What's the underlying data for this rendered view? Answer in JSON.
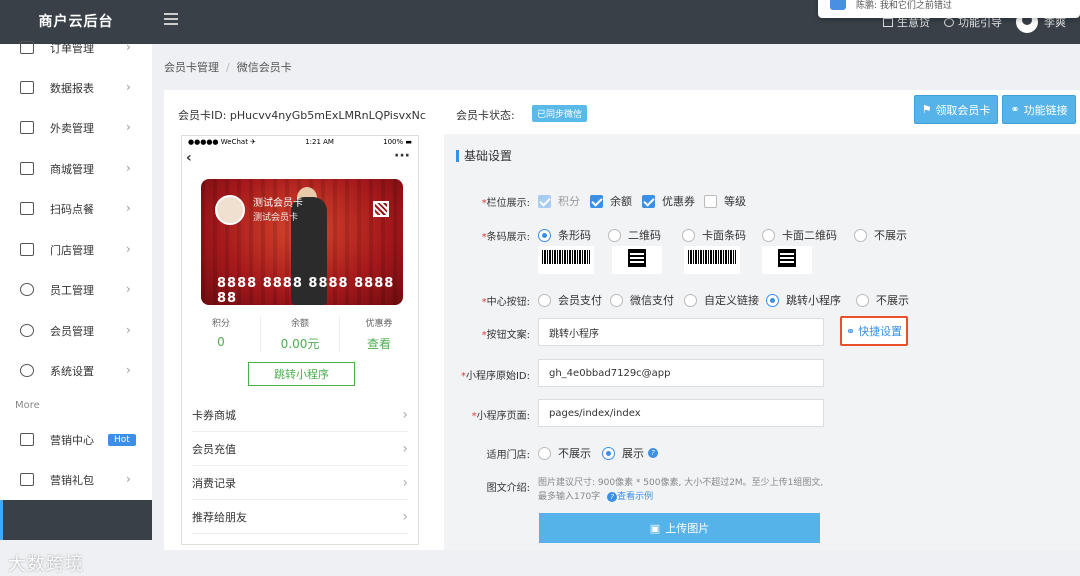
{
  "app": {
    "brand": "商户云后台"
  },
  "topbar": {
    "notification": "陈鹏: 我和它们之前错过",
    "items": [
      {
        "label": "生意贷"
      },
      {
        "label": "功能引导"
      },
      {
        "label": "李爽"
      }
    ]
  },
  "sidebar": {
    "items": [
      {
        "label": "订单管理",
        "icon": "cart-icon"
      },
      {
        "label": "数据报表",
        "icon": "bar-chart-icon"
      },
      {
        "label": "外卖管理",
        "icon": "cart-icon"
      },
      {
        "label": "商城管理",
        "icon": "shop-cart-icon"
      },
      {
        "label": "扫码点餐",
        "icon": "cup-icon"
      },
      {
        "label": "门店管理",
        "icon": "home-icon"
      },
      {
        "label": "员工管理",
        "icon": "user-icon"
      },
      {
        "label": "会员管理",
        "icon": "smile-icon"
      },
      {
        "label": "系统设置",
        "icon": "gear-icon"
      }
    ],
    "more_label": "More",
    "more_items": [
      {
        "label": "营销中心",
        "badge": "Hot",
        "icon": "grid-icon"
      },
      {
        "label": "营销礼包",
        "icon": "gift-icon"
      }
    ],
    "watermark": "大数跨境"
  },
  "breadcrumb": {
    "first": "会员卡管理",
    "sep": "/",
    "second": "微信会员卡"
  },
  "header": {
    "card_id_label": "会员卡ID: pHucvv4nyGb5mExLMRnLQPisvxNc",
    "status_label": "会员卡状态:",
    "status_badge": "已同步微信",
    "receive_button": "领取会员卡",
    "link_button": "功能链接"
  },
  "phone": {
    "carrier": "●●●●● WeChat ✈",
    "time": "1:21 AM",
    "battery": "100% ▬",
    "card_title": "测试会员卡",
    "card_subtitle": "测试会员卡",
    "card_number": "8888 8888 8888 8888 88",
    "stats": [
      {
        "label": "积分",
        "value": "0"
      },
      {
        "label": "余额",
        "value": "0.00元"
      },
      {
        "label": "优惠券",
        "value": "查看"
      }
    ],
    "jump_button": "跳转小程序",
    "list": [
      {
        "label": "卡券商城"
      },
      {
        "label": "会员充值"
      },
      {
        "label": "消费记录"
      },
      {
        "label": "推荐给朋友"
      }
    ]
  },
  "settings": {
    "title": "基础设置",
    "columns_label": "栏位展示:",
    "columns": [
      {
        "label": "积分",
        "state": "checked-disabled"
      },
      {
        "label": "余额",
        "state": "checked"
      },
      {
        "label": "优惠券",
        "state": "checked"
      },
      {
        "label": "等级",
        "state": "unchecked"
      }
    ],
    "barcode_label": "条码展示:",
    "barcode": [
      {
        "label": "条形码",
        "selected": true
      },
      {
        "label": "二维码",
        "selected": false
      },
      {
        "label": "卡面条码",
        "selected": false
      },
      {
        "label": "卡面二维码",
        "selected": false
      },
      {
        "label": "不展示",
        "selected": false
      }
    ],
    "center_label": "中心按钮:",
    "center": [
      {
        "label": "会员支付",
        "selected": false
      },
      {
        "label": "微信支付",
        "selected": false
      },
      {
        "label": "自定义链接",
        "selected": false
      },
      {
        "label": "跳转小程序",
        "selected": true
      },
      {
        "label": "不展示",
        "selected": false
      }
    ],
    "btn_text_label": "按钮文案:",
    "btn_text_value": "跳转小程序",
    "quick_setting": "快捷设置",
    "mini_id_label": "小程序原始ID:",
    "mini_id_value": "gh_4e0bbad7129c@app",
    "mini_page_label": "小程序页面:",
    "mini_page_value": "pages/index/index",
    "store_label": "适用门店:",
    "store": [
      {
        "label": "不展示",
        "selected": false
      },
      {
        "label": "展示",
        "selected": true
      }
    ],
    "intro_label": "图文介绍:",
    "intro_help": "图片建议尺寸: 900像素 * 500像素, 大小不超过2M。至少上传1组图文, 最多输入170字",
    "intro_example": "查看示例",
    "upload_button": "上传图片"
  }
}
